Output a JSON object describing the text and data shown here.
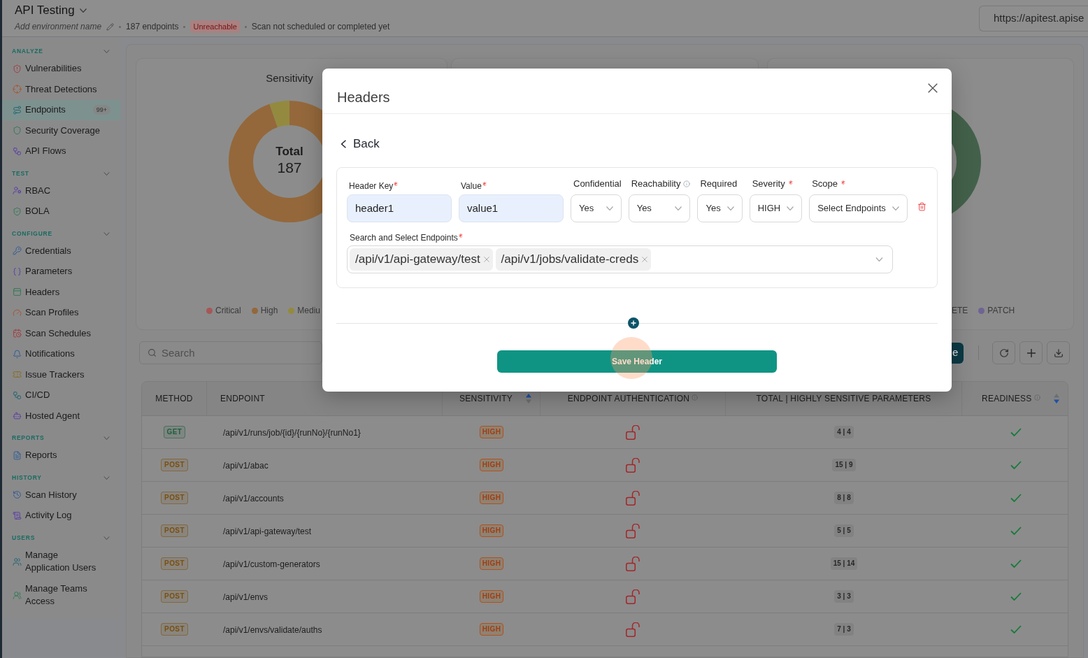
{
  "app_header": {
    "title": "API Testing",
    "environment_name": {
      "placeholder": "Add environment name"
    },
    "endpoint_count": "187 endpoints",
    "status": "Unreachable",
    "scan_status": "Scan not scheduled or completed yet",
    "url": "https://apitest.apise"
  },
  "sidebar": {
    "sections": [
      {
        "label": "ANALYZE",
        "expanded": true,
        "items": [
          {
            "label": "Vulnerabilities",
            "selected": false
          },
          {
            "label": "Threat Detections",
            "selected": false
          },
          {
            "label": "Endpoints",
            "selected": true,
            "badge": "99+"
          },
          {
            "label": "Security Coverage",
            "selected": false
          },
          {
            "label": "API Flows",
            "selected": false
          }
        ]
      },
      {
        "label": "TEST",
        "expanded": true,
        "items": [
          {
            "label": "RBAC",
            "selected": false
          },
          {
            "label": "BOLA",
            "selected": false
          }
        ]
      },
      {
        "label": "CONFIGURE",
        "expanded": true,
        "items": [
          {
            "label": "Credentials",
            "selected": false
          },
          {
            "label": "Parameters",
            "selected": false
          },
          {
            "label": "Headers",
            "selected": false
          },
          {
            "label": "Scan Profiles",
            "selected": false
          },
          {
            "label": "Scan Schedules",
            "selected": false
          },
          {
            "label": "Notifications",
            "selected": false
          },
          {
            "label": "Issue Trackers",
            "selected": false
          },
          {
            "label": "CI/CD",
            "selected": false
          },
          {
            "label": "Hosted Agent",
            "selected": false
          }
        ]
      },
      {
        "label": "REPORTS",
        "expanded": true,
        "items": [
          {
            "label": "Reports",
            "selected": false
          }
        ]
      },
      {
        "label": "HISTORY",
        "expanded": true,
        "items": [
          {
            "label": "Scan History",
            "selected": false
          },
          {
            "label": "Activity Log",
            "selected": false
          }
        ]
      },
      {
        "label": "USERS",
        "expanded": true,
        "items": [
          {
            "label": "Manage Application Users",
            "selected": false
          },
          {
            "label": "Manage Teams Access",
            "selected": false
          }
        ]
      }
    ]
  },
  "charts": [
    {
      "title": "Sensitivity",
      "center_label": "Total",
      "center_value": "187",
      "legend": [
        {
          "label": "Critical",
          "color": "#a85656"
        },
        {
          "label": "High",
          "color": "#94683b"
        },
        {
          "label": "Mediu",
          "color": "#938a3f"
        }
      ]
    },
    {
      "legend": [
        {
          "label": "ETE"
        },
        {
          "label": "PATCH",
          "color": "#6f6494"
        }
      ]
    }
  ],
  "toolbar": {
    "search": {
      "placeholder": "Search"
    },
    "primary_button": "e"
  },
  "table": {
    "columns": [
      {
        "label": "METHOD"
      },
      {
        "label": "ENDPOINT"
      },
      {
        "label": "SENSITIVITY",
        "sortable": true,
        "sort_ascending": true
      },
      {
        "label": "ENDPOINT AUTHENTICATION",
        "info": true
      },
      {
        "label": "TOTAL | HIGHLY SENSITIVE PARAMETERS"
      },
      {
        "label": "READINESS",
        "info": true,
        "sortable": true,
        "sort_ascending": false
      }
    ],
    "rows": [
      {
        "method": {
          "label": "GET",
          "color": "#1f5e3c"
        },
        "endpoint": "/api/v1/runs/job/{id}/{runNo}/{runNo1}",
        "sensitivity": "HIGH",
        "authenticated": false,
        "parameters": "4 | 4",
        "ready": true
      },
      {
        "method": {
          "label": "POST",
          "color": "#7a4f10"
        },
        "endpoint": "/api/v1/abac",
        "sensitivity": "HIGH",
        "authenticated": false,
        "parameters": "15 | 9",
        "ready": true
      },
      {
        "method": {
          "label": "POST",
          "color": "#7a4f10"
        },
        "endpoint": "/api/v1/accounts",
        "sensitivity": "HIGH",
        "authenticated": false,
        "parameters": "8 | 8",
        "ready": true
      },
      {
        "method": {
          "label": "POST",
          "color": "#7a4f10"
        },
        "endpoint": "/api/v1/api-gateway/test",
        "sensitivity": "HIGH",
        "authenticated": false,
        "parameters": "5 | 5",
        "ready": true
      },
      {
        "method": {
          "label": "POST",
          "color": "#7a4f10"
        },
        "endpoint": "/api/v1/custom-generators",
        "sensitivity": "HIGH",
        "authenticated": false,
        "parameters": "15 | 14",
        "ready": true
      },
      {
        "method": {
          "label": "POST",
          "color": "#7a4f10"
        },
        "endpoint": "/api/v1/envs",
        "sensitivity": "HIGH",
        "authenticated": false,
        "parameters": "3 | 3",
        "ready": true
      },
      {
        "method": {
          "label": "POST",
          "color": "#7a4f10"
        },
        "endpoint": "/api/v1/envs/validate/auths",
        "sensitivity": "HIGH",
        "authenticated": false,
        "parameters": "7 | 3",
        "ready": true
      }
    ]
  },
  "modal": {
    "title": "Headers",
    "back": "Back",
    "header_rows": [
      {
        "fields": [
          {
            "kind": "text",
            "label": "Header Key",
            "required": true,
            "value": "header1"
          },
          {
            "kind": "text",
            "label": "Value",
            "required": true,
            "value": "value1"
          },
          {
            "kind": "select",
            "label": "Confidential",
            "value": "Yes"
          },
          {
            "kind": "select",
            "label": "Reachability",
            "info": true,
            "value": "Yes"
          },
          {
            "kind": "select",
            "label": "Required",
            "value": "Yes"
          },
          {
            "kind": "select",
            "label": "Severity",
            "required": true,
            "value": "HIGH"
          },
          {
            "kind": "select",
            "label": "Scope",
            "required": true,
            "value": "Select Endpoints"
          }
        ],
        "endpoints": {
          "label": "Search and Select Endpoints",
          "required": true,
          "selected": [
            "/api/v1/api-gateway/test",
            "/api/v1/jobs/validate-creds"
          ]
        }
      }
    ],
    "save_button": "Save Header"
  }
}
